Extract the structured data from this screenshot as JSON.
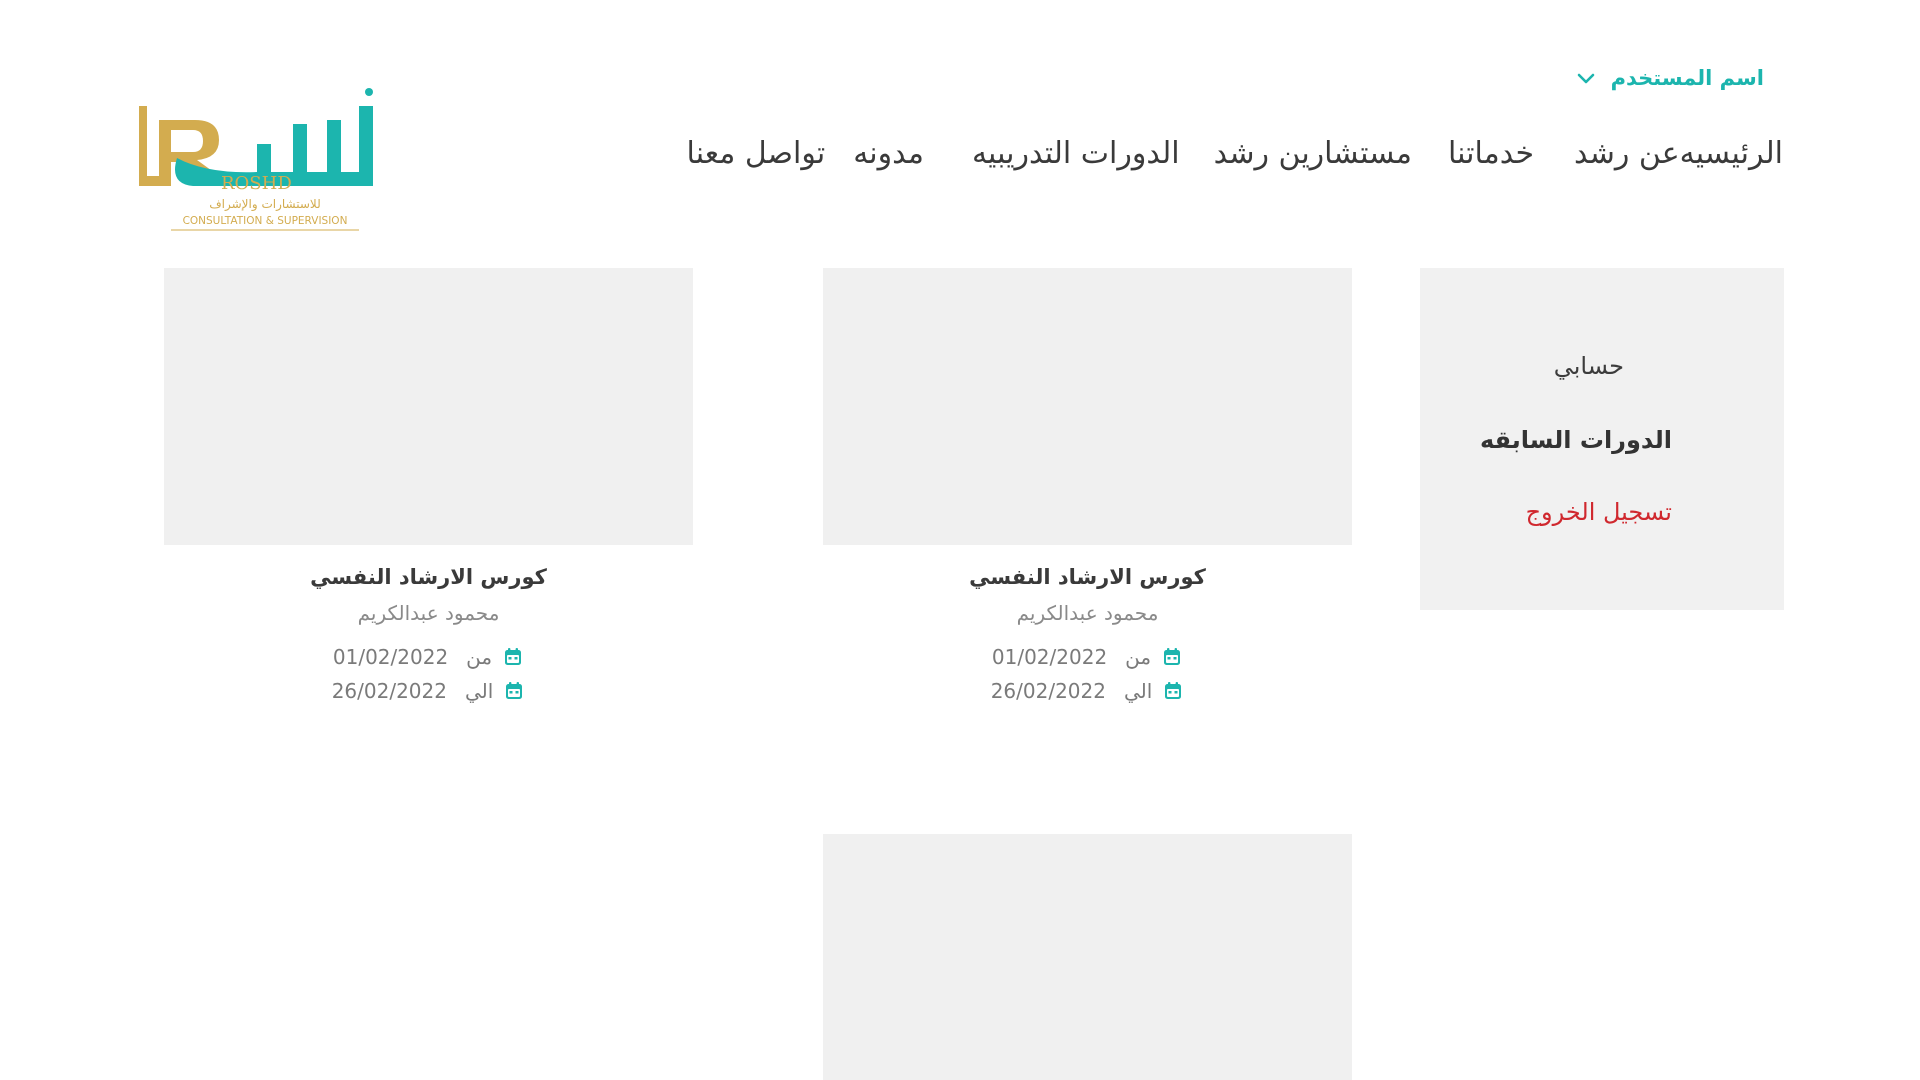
{
  "brand": {
    "logo_arabic": "رُشد",
    "logo_latin": "ROSHD",
    "tagline_arabic": "للاستشارات والإشراف",
    "tagline_english": "CONSULTATION & SUPERVISION",
    "colors": {
      "teal": "#1cb5ae",
      "gold": "#d3ac4f"
    }
  },
  "user_menu": {
    "label": "اسم المستخدم",
    "icon": "chevron-down-icon"
  },
  "nav": {
    "items": [
      {
        "label": "تواصل معنا"
      },
      {
        "label": "مدونه"
      },
      {
        "label": "الدورات التدريبيه"
      },
      {
        "label": "مستشارين رشد"
      },
      {
        "label": "خدماتنا"
      },
      {
        "label": "عن رشد"
      },
      {
        "label": "الرئيسيه"
      }
    ]
  },
  "sidebar": {
    "account": "حسابي",
    "past_courses": "الدورات السابقه",
    "logout": "تسجيل الخروج",
    "logout_color": "#d0282e"
  },
  "courses": [
    {
      "title": "كورس الارشاد النفسي",
      "instructor": "محمود عبدالكريم",
      "from_label": "من",
      "from_date": "01/02/2022",
      "to_label": "الي",
      "to_date": "26/02/2022"
    },
    {
      "title": "كورس الارشاد النفسي",
      "instructor": "محمود عبدالكريم",
      "from_label": "من",
      "from_date": "01/02/2022",
      "to_label": "الي",
      "to_date": "26/02/2022"
    },
    {
      "title": "",
      "instructor": "",
      "from_label": "",
      "from_date": "",
      "to_label": "",
      "to_date": ""
    }
  ]
}
